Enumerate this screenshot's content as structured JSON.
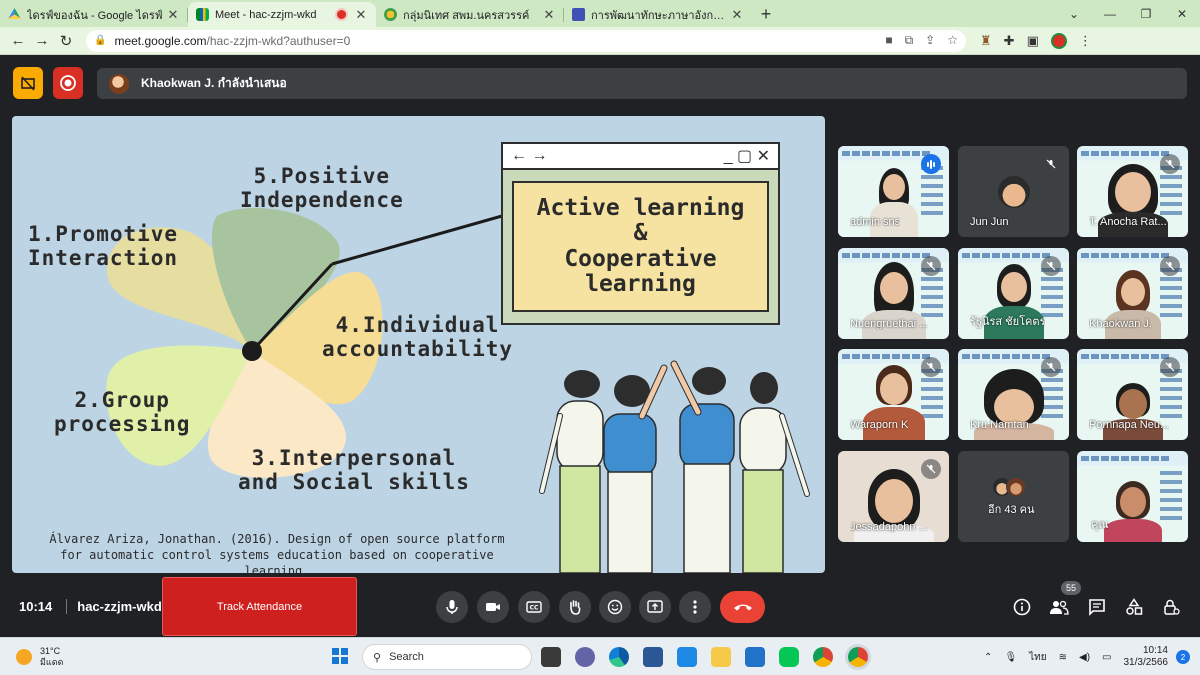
{
  "browser": {
    "tabs": [
      {
        "title": "ไดรฟ์ของฉัน - Google ไดรฟ์",
        "active": false
      },
      {
        "title": "Meet - hac-zzjm-wkd",
        "active": true
      },
      {
        "title": "กลุ่มนิเทศ สพม.นครสวรรค์",
        "active": false
      },
      {
        "title": "การพัฒนาทักษะภาษาอังกฤษ English",
        "active": false
      }
    ],
    "close_glyph": "✕",
    "new_tab_glyph": "+",
    "url_host": "meet.google.com",
    "url_path": "/hac-zzjm-wkd?authuser=0"
  },
  "meet": {
    "presenting_text": "Khaokwan J. กำลังนำเสนอ",
    "meeting_time": "10:14",
    "meeting_code": "hac-zzjm-wkd",
    "track_attendance_label": "Track Attendance",
    "participant_count": "55",
    "colors": {
      "end_call": "#ea4335",
      "track": "#cf2020",
      "active_border": "#8ab4f8"
    }
  },
  "slide": {
    "label_1": "1.Promotive\nInteraction",
    "label_2": "2.Group\nprocessing",
    "label_3": "3.Interpersonal\nand Social skills",
    "label_4": "4.Individual\naccountability",
    "label_5": "5.Positive\nIndependence",
    "window_title_left": "←  →",
    "window_title_right": "_  ▢  ✕",
    "window_text": "Active learning\n&\nCooperative\nlearning",
    "citation": "Álvarez Ariza, Jonathan. (2016). Design of open source platform for automatic control systems education based on cooperative learning."
  },
  "participants": [
    {
      "name": "admin sns"
    },
    {
      "name": "Jun Jun"
    },
    {
      "name": "T. Anocha Rat..."
    },
    {
      "name": "Nuengruethai ..."
    },
    {
      "name": "รัฐนิรส ชัยโคตร"
    },
    {
      "name": "Khaokwan J."
    },
    {
      "name": "Waraporn K"
    },
    {
      "name": "Kru Namtan"
    },
    {
      "name": "Pornnapa Neu..."
    },
    {
      "name": "Jessadapohn ..."
    },
    {
      "name": "อีก 43 คน"
    },
    {
      "name": "คุณ"
    }
  ],
  "taskbar": {
    "temperature": "31°C",
    "weather_text": "มีแดด",
    "search_placeholder": "Search",
    "language": "ไทย",
    "time": "10:14",
    "date": "31/3/2566",
    "notification_count": "2"
  }
}
